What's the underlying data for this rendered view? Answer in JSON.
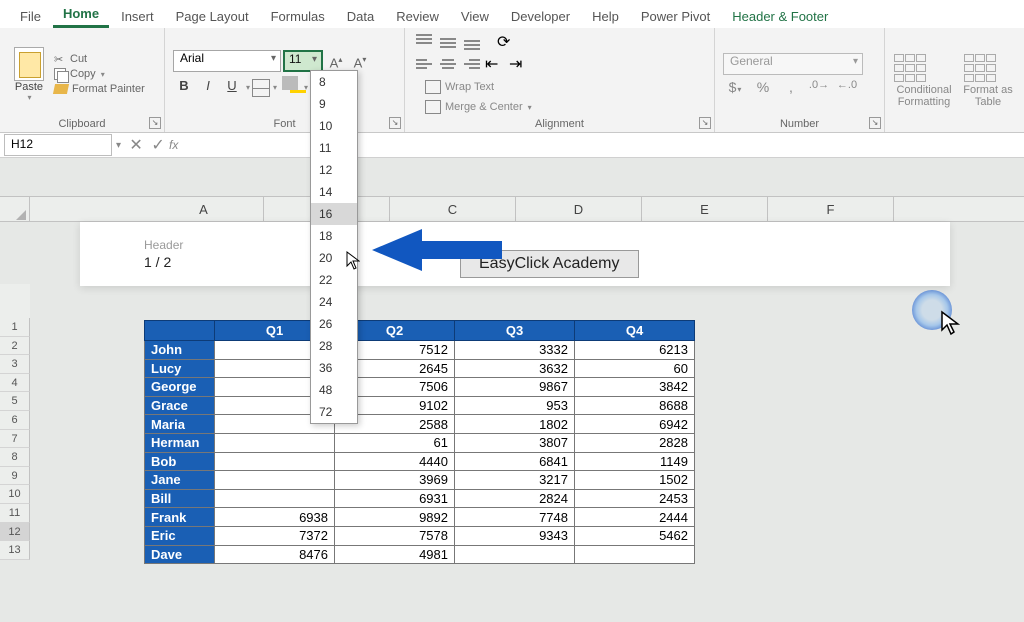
{
  "ribbon": {
    "tabs": [
      "File",
      "Home",
      "Insert",
      "Page Layout",
      "Formulas",
      "Data",
      "Review",
      "View",
      "Developer",
      "Help",
      "Power Pivot",
      "Header & Footer"
    ],
    "active_tab": "Home",
    "clipboard": {
      "label": "Clipboard",
      "paste": "Paste",
      "cut": "Cut",
      "copy": "Copy",
      "format_painter": "Format Painter"
    },
    "font": {
      "label": "Font",
      "name": "Arial",
      "size": "11",
      "sizes": [
        "8",
        "9",
        "10",
        "11",
        "12",
        "14",
        "16",
        "18",
        "20",
        "22",
        "24",
        "26",
        "28",
        "36",
        "48",
        "72"
      ],
      "hover_size": "16"
    },
    "alignment": {
      "label": "Alignment",
      "wrap": "Wrap Text",
      "merge": "Merge & Center"
    },
    "number": {
      "label": "Number",
      "format": "General"
    },
    "styles": {
      "conditional": "Conditional Formatting",
      "format_table": "Format as Table"
    }
  },
  "namebox": "H12",
  "header": {
    "label": "Header",
    "page": "1 / 2",
    "center": "EasyClick Academy"
  },
  "columns": [
    "A",
    "B",
    "C",
    "D",
    "E",
    "F"
  ],
  "rows": [
    "1",
    "2",
    "3",
    "4",
    "5",
    "6",
    "7",
    "8",
    "9",
    "10",
    "11",
    "12",
    "13"
  ],
  "selected_row": "12",
  "table": {
    "headers": [
      "",
      "Q1",
      "Q2",
      "Q3",
      "Q4"
    ],
    "rows": [
      {
        "name": "John",
        "q1": "",
        "q2": "7512",
        "q3": "3332",
        "q4": "6213"
      },
      {
        "name": "Lucy",
        "q1": "",
        "q2": "2645",
        "q3": "3632",
        "q4": "60"
      },
      {
        "name": "George",
        "q1": "",
        "q2": "7506",
        "q3": "9867",
        "q4": "3842"
      },
      {
        "name": "Grace",
        "q1": "",
        "q2": "9102",
        "q3": "953",
        "q4": "8688"
      },
      {
        "name": "Maria",
        "q1": "",
        "q2": "2588",
        "q3": "1802",
        "q4": "6942"
      },
      {
        "name": "Herman",
        "q1": "",
        "q2": "61",
        "q3": "3807",
        "q4": "2828"
      },
      {
        "name": "Bob",
        "q1": "",
        "q2": "4440",
        "q3": "6841",
        "q4": "1149"
      },
      {
        "name": "Jane",
        "q1": "",
        "q2": "3969",
        "q3": "3217",
        "q4": "1502"
      },
      {
        "name": "Bill",
        "q1": "",
        "q2": "6931",
        "q3": "2824",
        "q4": "2453"
      },
      {
        "name": "Frank",
        "q1": "6938",
        "q2": "9892",
        "q3": "7748",
        "q4": "2444"
      },
      {
        "name": "Eric",
        "q1": "7372",
        "q2": "7578",
        "q3": "9343",
        "q4": "5462"
      },
      {
        "name": "Dave",
        "q1": "8476",
        "q2": "4981",
        "q3": "",
        "q4": ""
      }
    ]
  }
}
